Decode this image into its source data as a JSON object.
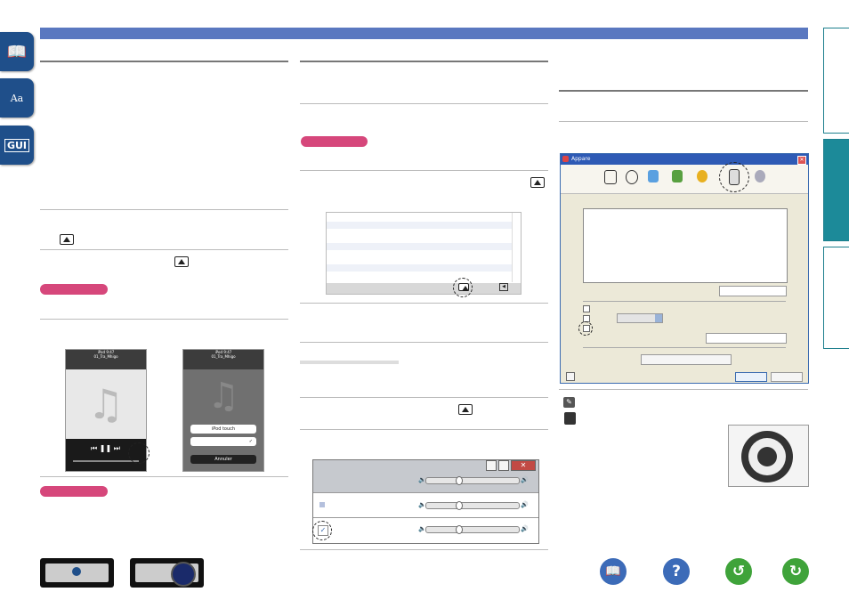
{
  "side_icons": [
    {
      "name": "book-icon",
      "glyph": "📖"
    },
    {
      "name": "dictionary-icon",
      "glyph": "Aa"
    },
    {
      "name": "gui-icon",
      "glyph": "GUI"
    }
  ],
  "right_tabs": [
    {
      "name": "tab-top",
      "active": false
    },
    {
      "name": "tab-middle",
      "active": true
    },
    {
      "name": "tab-bottom",
      "active": false
    }
  ],
  "iphone_screen": {
    "left": {
      "status": "iPod",
      "time": "9:47",
      "track": "01_Tra_Mhigo"
    },
    "right": {
      "status": "iPod",
      "time": "9:47",
      "track": "01_Tra_Mhigo",
      "menu": [
        "iPod touch",
        "",
        "Annuler"
      ]
    }
  },
  "itunes_window": {
    "title": "Appare"
  },
  "colors": {
    "accent": "#5a78c0",
    "pink": "#d6477b",
    "navy": "#1f4f8a",
    "teal": "#1c8a99",
    "green": "#3fa33a"
  },
  "bottom_nav": [
    {
      "name": "book-nav-button",
      "color": "#3c6bb8"
    },
    {
      "name": "help-button",
      "glyph": "?",
      "color": "#3c6bb8"
    },
    {
      "name": "back-button",
      "glyph": "↺",
      "color": "#3fa33a"
    },
    {
      "name": "forward-button",
      "glyph": "↻",
      "color": "#3fa33a"
    }
  ]
}
